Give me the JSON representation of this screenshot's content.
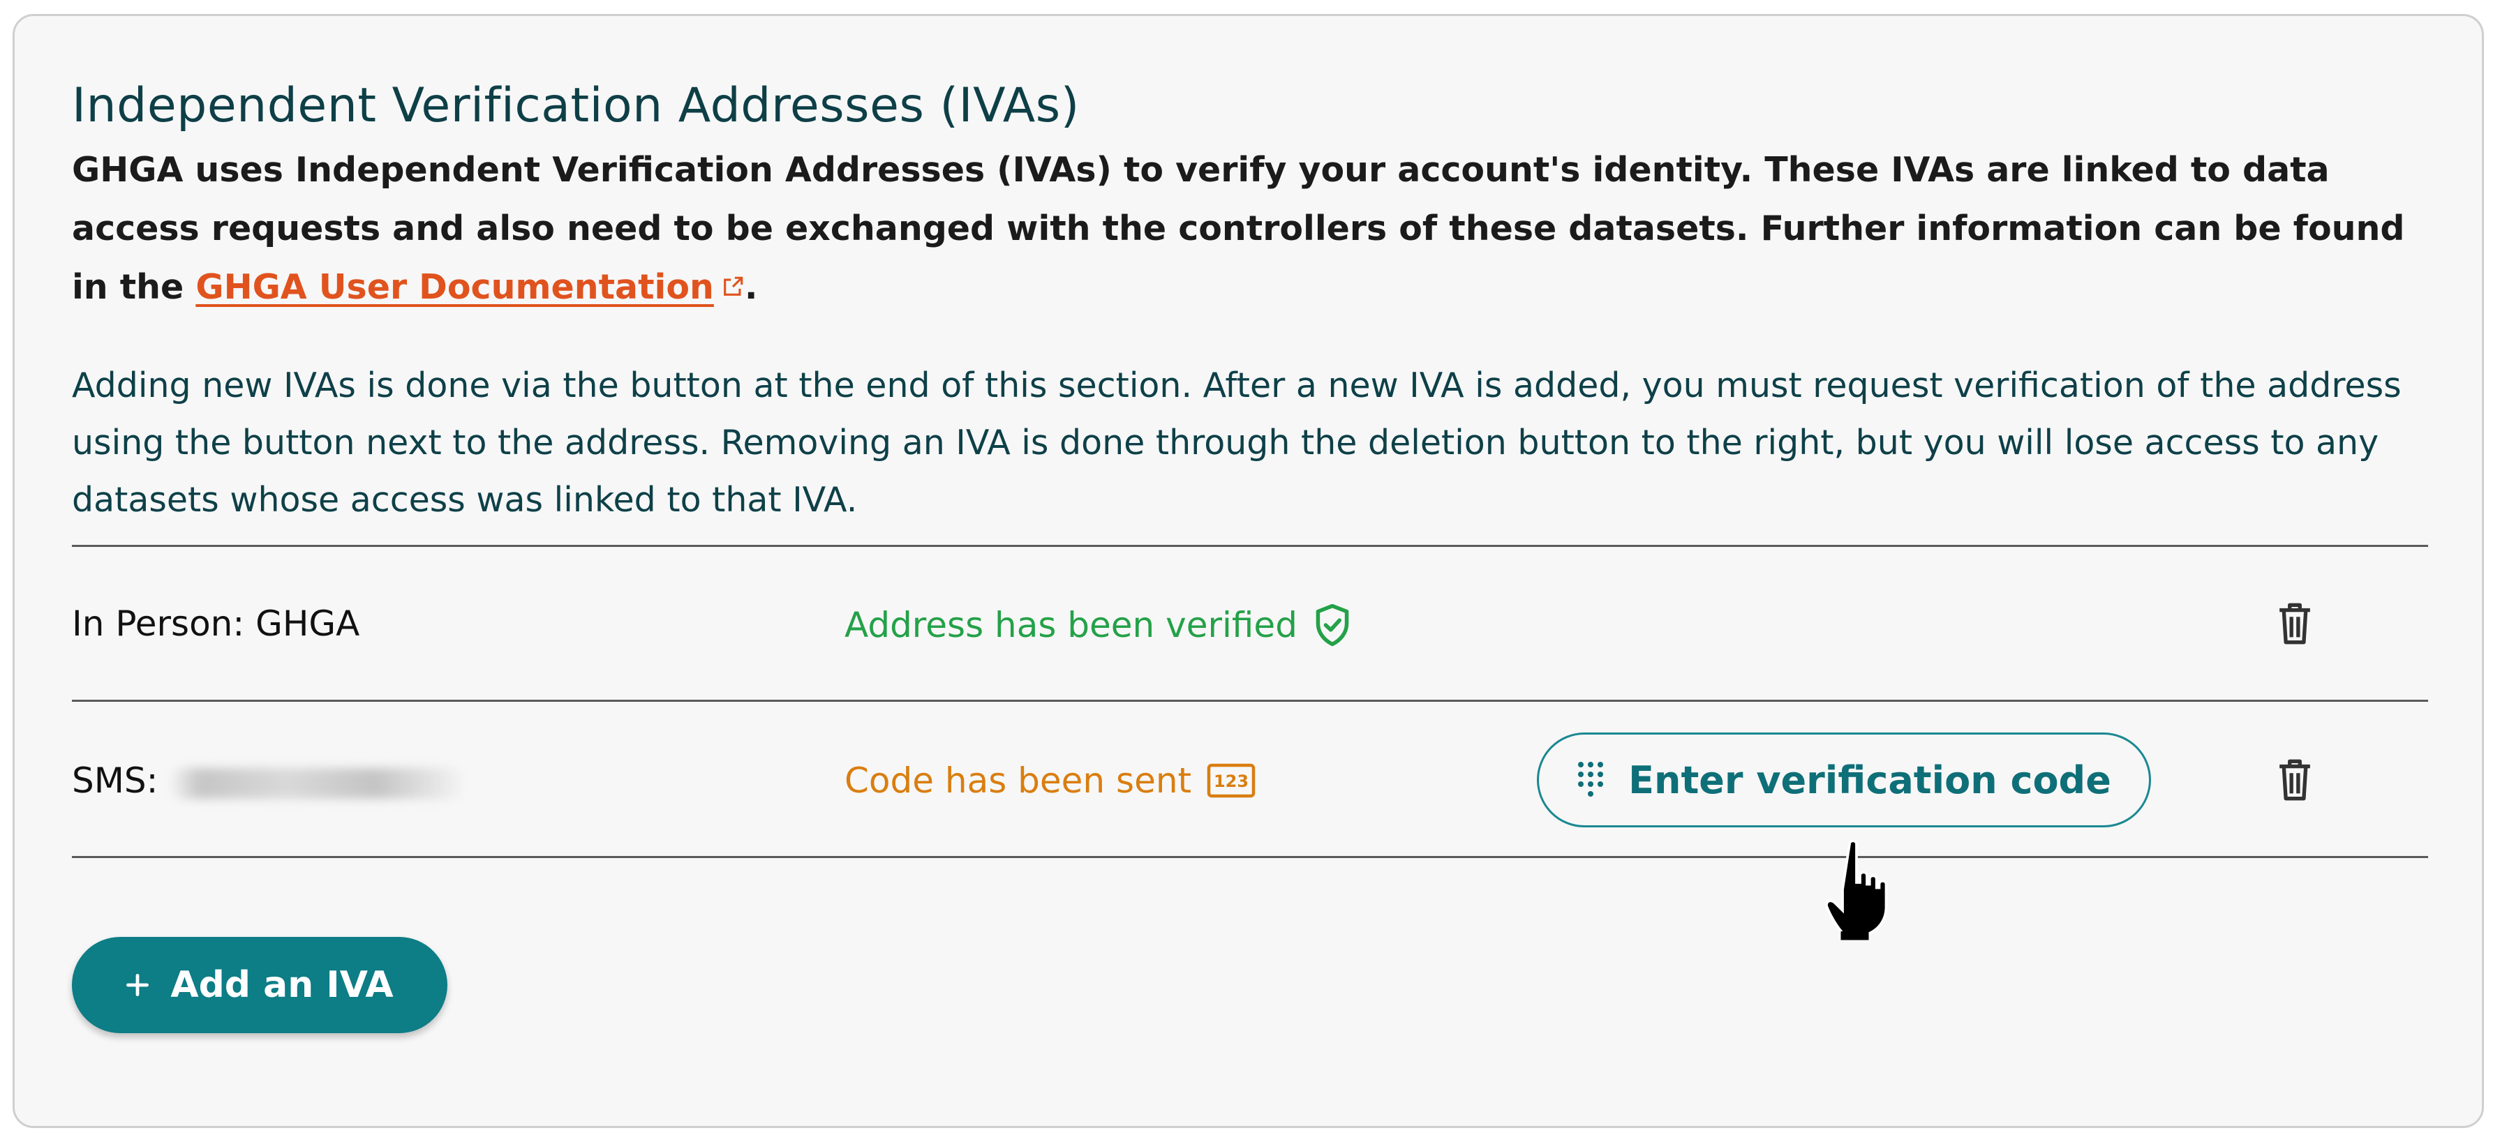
{
  "section": {
    "title": "Independent Verification Addresses (IVAs)",
    "intro_text": "GHGA uses Independent Verification Addresses (IVAs) to verify your account's identity. These IVAs are linked to data access requests and also need to be exchanged with the controllers of these datasets. Further information can be found in the ",
    "doc_link_label": "GHGA User Documentation",
    "intro_end": ".",
    "instructions": "Adding new IVAs is done via the button at the end of this section. After a new IVA is added, you must request verification of the address using the button next to the address. Removing an IVA is done through the deletion button to the right, but you will lose access to any datasets whose access was linked to that IVA."
  },
  "ivas": [
    {
      "label": "In Person: GHGA",
      "status": "Address has been verified",
      "status_icon": "shield-check-icon",
      "status_color": "#24a148",
      "action": null,
      "delete_icon": "trash-icon"
    },
    {
      "label": "SMS:",
      "value_masked": true,
      "status": "Code has been sent",
      "status_icon": "numeric-123-icon",
      "status_color": "#d97e10",
      "action": {
        "label": "Enter verification code",
        "icon": "dialpad-icon"
      },
      "delete_icon": "trash-icon"
    }
  ],
  "add_button": {
    "icon": "plus-icon",
    "label": "Add an IVA"
  },
  "colors": {
    "accent": "#0d7d86",
    "link": "#e0531e",
    "title": "#0e3f47"
  }
}
